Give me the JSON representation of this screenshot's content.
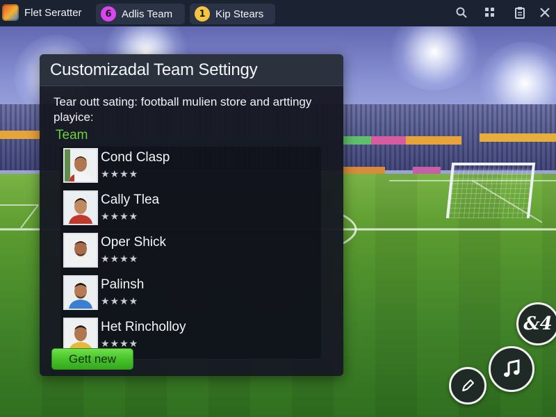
{
  "topbar": {
    "app_title": "Flet Seratter",
    "tabs": [
      {
        "badge": "6",
        "badge_color": "#d946ef",
        "label": "Adlis Team"
      },
      {
        "badge": "1",
        "badge_color": "#f5c542",
        "label": "Kip Stears"
      }
    ],
    "icons": [
      "search-icon",
      "grid-icon",
      "clipboard-icon",
      "close-icon"
    ]
  },
  "panel": {
    "title": "Customizadal Team Settingy",
    "description": "Tear outt sating: football mulien store and arttingy playice:",
    "section_label": "Team",
    "players": [
      {
        "name": "Cond Clasp",
        "rating": "★★★★"
      },
      {
        "name": "Cally Tlea",
        "rating": "★★★★"
      },
      {
        "name": "Oper Shick",
        "rating": "★★★★"
      },
      {
        "name": "Palinsh",
        "rating": "★★★★"
      },
      {
        "name": "Het Rincholloy",
        "rating": "★★★★"
      }
    ],
    "button_label": "Gett new"
  },
  "fabs": {
    "top_label": "&4",
    "middle_icon": "music-note-icon",
    "bottom_icon": "pencil-icon"
  },
  "colors": {
    "accent_green": "#45c029",
    "section_label": "#6ad13a",
    "topbar_bg": "#1b2232"
  }
}
